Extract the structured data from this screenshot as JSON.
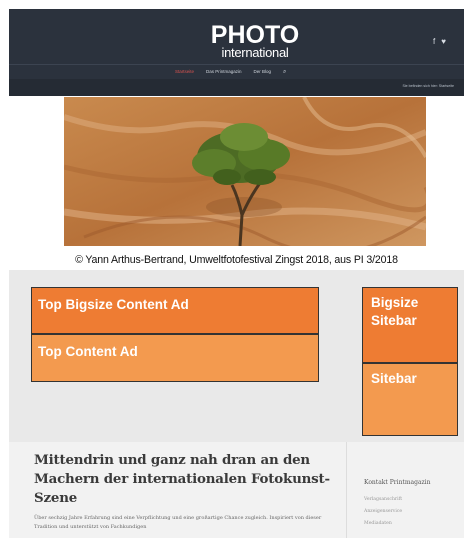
{
  "header": {
    "logo_main": "PHOTO",
    "logo_sub": "international",
    "social": [
      "f",
      "♥"
    ],
    "nav": [
      {
        "label": "Startseite",
        "active": true
      },
      {
        "label": "Das Printmagazin",
        "active": false
      },
      {
        "label": "Der Blog",
        "active": false
      }
    ],
    "search_icon": "⌕",
    "breadcrumb": "Sie befinden sich hier: Startseite"
  },
  "hero": {
    "caption": "© Yann Arthus-Bertrand, Umweltfotofestival Zingst 2018, aus PI 3/2018"
  },
  "ads": {
    "top_bigsize": "Top Bigsize Content Ad",
    "top_content": "Top Content Ad",
    "bigsize_sitebar": "Bigsize Sitebar",
    "sitebar": "Sitebar"
  },
  "article": {
    "headline": "Mittendrin und ganz nah dran an den Machern der internationalen Fotokunst-Szene",
    "intro": "Über sechzig Jahre Erfahrung sind eine Verpflichtung und eine großartige Chance zugleich. Inspiriert von dieser Tradition und unterstützt von Fachkundigen"
  },
  "sidebar": {
    "title": "Kontakt Printmagazin",
    "links": [
      "Verlagsanschrift",
      "Anzeigenservice",
      "Mediadaten"
    ]
  },
  "colors": {
    "header_bg": "#2b323d",
    "ad_dark": "#ee7c33",
    "ad_light": "#f39a4f",
    "nav_active": "#d9534f"
  }
}
